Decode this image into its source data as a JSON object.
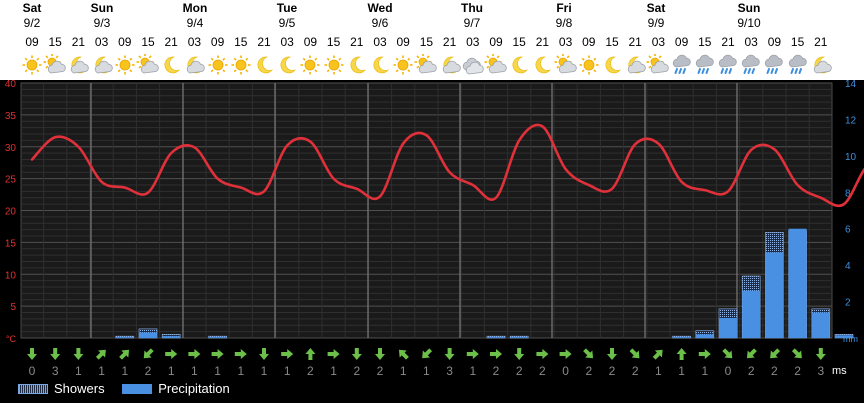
{
  "header": {
    "days": [
      {
        "name": "Sat",
        "date": "9/2"
      },
      {
        "name": "Sun",
        "date": "9/3"
      },
      {
        "name": "Mon",
        "date": "9/4"
      },
      {
        "name": "Tue",
        "date": "9/5"
      },
      {
        "name": "Wed",
        "date": "9/6"
      },
      {
        "name": "Thu",
        "date": "9/7"
      },
      {
        "name": "Fri",
        "date": "9/8"
      },
      {
        "name": "Sat",
        "date": "9/9"
      },
      {
        "name": "Sun",
        "date": "9/10"
      }
    ],
    "hours": [
      "09",
      "15",
      "21",
      "03",
      "09",
      "15",
      "21",
      "03",
      "09",
      "15",
      "21",
      "03",
      "09",
      "15",
      "21",
      "03",
      "09",
      "15",
      "21",
      "03",
      "09",
      "15",
      "21",
      "03",
      "09",
      "15",
      "21",
      "03",
      "09",
      "15",
      "21",
      "03",
      "09",
      "15",
      "21"
    ],
    "icons": [
      "sun-icon",
      "sun-cloud-icon",
      "moon-cloud-icon",
      "moon-cloud-icon",
      "sun-icon",
      "sun-cloud-icon",
      "moon-icon",
      "moon-cloud-icon",
      "sun-icon",
      "sun-icon",
      "moon-icon",
      "moon-icon",
      "sun-icon",
      "sun-icon",
      "moon-icon",
      "moon-icon",
      "sun-icon",
      "sun-cloud-icon",
      "moon-cloud-icon",
      "cloud-icon",
      "sun-cloud-icon",
      "moon-icon",
      "moon-icon",
      "sun-cloud-icon",
      "sun-icon",
      "moon-icon",
      "moon-cloud-icon",
      "sun-cloud-icon",
      "rain-icon",
      "rain-icon",
      "rain-icon",
      "rain-icon",
      "rain-icon",
      "rain-icon",
      "moon-cloud-icon"
    ]
  },
  "chart_data": {
    "type": "line",
    "title": "",
    "x": [
      "9/2 09",
      "9/2 15",
      "9/2 21",
      "9/3 03",
      "9/3 09",
      "9/3 15",
      "9/3 21",
      "9/4 03",
      "9/4 09",
      "9/4 15",
      "9/4 21",
      "9/5 03",
      "9/5 09",
      "9/5 15",
      "9/5 21",
      "9/6 03",
      "9/6 09",
      "9/6 15",
      "9/6 21",
      "9/7 03",
      "9/7 09",
      "9/7 15",
      "9/7 21",
      "9/8 03",
      "9/8 09",
      "9/8 15",
      "9/8 21",
      "9/9 03",
      "9/9 09",
      "9/9 15",
      "9/9 21",
      "9/10 03",
      "9/10 09",
      "9/10 15",
      "9/10 21"
    ],
    "series": [
      {
        "name": "",
        "axis": "left",
        "unit": "°C",
        "values": [
          28,
          31.5,
          24.5,
          23,
          29.5,
          25,
          23.5,
          30.5,
          25,
          23,
          31.5,
          25,
          23,
          33,
          25,
          23.5,
          30.5,
          24.5,
          23.5,
          29.5,
          24.5,
          22.5,
          21,
          28,
          23.5,
          20.5,
          20,
          25,
          21,
          20.5,
          19.5,
          25,
          20.5,
          20.5,
          20
        ]
      }
    ],
    "temperature_curve_points": [
      [
        0,
        28
      ],
      [
        0.5,
        31.5
      ],
      [
        1,
        30
      ],
      [
        1.5,
        24.5
      ],
      [
        2,
        23.6
      ],
      [
        2.5,
        22.8
      ],
      [
        3,
        29
      ],
      [
        3.5,
        29.9
      ],
      [
        4,
        25
      ],
      [
        4.5,
        23.6
      ],
      [
        5,
        23
      ],
      [
        5.5,
        30.2
      ],
      [
        6,
        30.8
      ],
      [
        6.5,
        25
      ],
      [
        7,
        23.4
      ],
      [
        7.5,
        22.2
      ],
      [
        8,
        30.5
      ],
      [
        8.5,
        31.8
      ],
      [
        9,
        26
      ],
      [
        9.5,
        24
      ],
      [
        10,
        22
      ],
      [
        10.5,
        31
      ],
      [
        11,
        33.2
      ],
      [
        11.5,
        26.5
      ],
      [
        12,
        24
      ],
      [
        12.5,
        23.4
      ],
      [
        13,
        30.4
      ],
      [
        13.5,
        30.5
      ],
      [
        14,
        24.5
      ],
      [
        14.5,
        23.2
      ],
      [
        15,
        23
      ],
      [
        15.5,
        29.5
      ],
      [
        16,
        29.6
      ],
      [
        16.5,
        24
      ],
      [
        17,
        22
      ],
      [
        17.5,
        21
      ],
      [
        18,
        27
      ],
      [
        18.5,
        27.8
      ],
      [
        19,
        24
      ],
      [
        19.5,
        21.8
      ],
      [
        20,
        20.4
      ],
      [
        20.5,
        19.5
      ],
      [
        21,
        24
      ],
      [
        21.5,
        25
      ],
      [
        22,
        22.5
      ],
      [
        22.5,
        20.4
      ]
    ],
    "y_left": {
      "unit": "°C",
      "ticks": [
        40,
        35,
        30,
        25,
        20,
        15,
        10,
        5
      ],
      "range": [
        0,
        40
      ]
    },
    "y_right": {
      "unit": "mm",
      "ticks": [
        14,
        12,
        10,
        8,
        6,
        4,
        2
      ],
      "range": [
        0,
        14
      ]
    },
    "precipitation": {
      "name": "Precipitation",
      "unit": "mm",
      "values": [
        0,
        0,
        0,
        0,
        0.05,
        0.3,
        0.1,
        0,
        0.05,
        0,
        0,
        0,
        0,
        0,
        0,
        0,
        0,
        0,
        0,
        0,
        0.05,
        0.05,
        0,
        0,
        0,
        0,
        0,
        0,
        0.05,
        0.2,
        1.1,
        2.6,
        4.7,
        6,
        1.4,
        0.15
      ]
    },
    "showers": {
      "name": "Showers",
      "unit": "mm",
      "values": [
        0,
        0,
        0,
        0,
        0.1,
        0.5,
        0.2,
        0,
        0.1,
        0,
        0,
        0,
        0,
        0,
        0,
        0,
        0,
        0,
        0,
        0,
        0.1,
        0.1,
        0,
        0,
        0,
        0,
        0,
        0,
        0.1,
        0.4,
        1.6,
        3.4,
        5.8,
        5.9,
        1.6,
        0.2
      ]
    },
    "wind": {
      "unit": "ms",
      "values": [
        0,
        3,
        1,
        1,
        1,
        2,
        1,
        1,
        1,
        1,
        1,
        1,
        2,
        1,
        2,
        2,
        1,
        1,
        3,
        1,
        2,
        2,
        2,
        0,
        2,
        2,
        2,
        1,
        1,
        1,
        0,
        2,
        2,
        2,
        3,
        2,
        2,
        1
      ],
      "directions": [
        "down",
        "down",
        "down",
        "up-right",
        "up-right",
        "down-left",
        "right",
        "right",
        "right",
        "right",
        "down",
        "right",
        "up",
        "right",
        "down",
        "down",
        "up-left",
        "down-left",
        "down",
        "right",
        "right",
        "down",
        "right",
        "right",
        "down-right",
        "down",
        "down-right",
        "up-right",
        "up",
        "right",
        "down-right",
        "down-left",
        "down-left",
        "down-right",
        "down",
        "down-left",
        "down-right",
        "up-right"
      ]
    },
    "grid": true,
    "legend": "bottom-left"
  },
  "legend": {
    "showers": "Showers",
    "precipitation": "Precipitation"
  },
  "units": {
    "left": "°C",
    "right": "mm",
    "wind": "ms"
  },
  "colors": {
    "temperature": "#e0303a",
    "precipitation": "#4a90e2",
    "left_axis": "#e03030",
    "right_axis": "#3d8fe0",
    "wind_arrow": "#6cc04a"
  }
}
